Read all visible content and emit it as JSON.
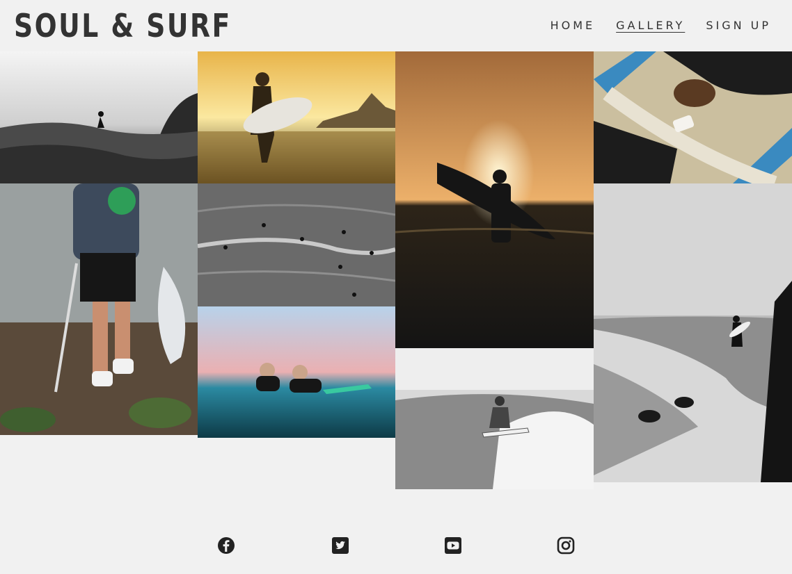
{
  "header": {
    "logo": "SOUL & SURF",
    "nav": [
      {
        "label": "HOME"
      },
      {
        "label": "GALLERY",
        "active": true
      },
      {
        "label": "SIGN UP"
      }
    ]
  },
  "gallery": {
    "photos": [
      {
        "subject": "surfer riding wave, black and white"
      },
      {
        "subject": "woman holding surfboard at golden sunset"
      },
      {
        "subject": "surfer silhouette with board against sunset over water"
      },
      {
        "subject": "hands waxing a blue surfboard"
      },
      {
        "subject": "person picking up litter on rocky beach"
      },
      {
        "subject": "surfers waiting in the lineup, black and white"
      },
      {
        "subject": "two surfers smiling in the water at pink dusk"
      },
      {
        "subject": "surfer crouching on a breaking wave, black and white"
      },
      {
        "subject": "surfer walking along the shoreline, black and white"
      }
    ]
  },
  "footer": {
    "social": [
      {
        "icon": "facebook-icon"
      },
      {
        "icon": "twitter-icon"
      },
      {
        "icon": "youtube-icon"
      },
      {
        "icon": "instagram-icon"
      }
    ]
  },
  "colors": {
    "background": "#f1f1f1",
    "text": "#333333"
  }
}
